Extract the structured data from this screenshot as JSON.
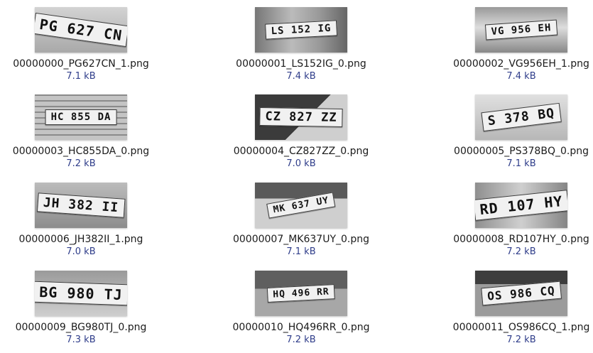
{
  "items": [
    {
      "plate": "PG 627 CN",
      "name": "00000000_PG627CN_1.png",
      "size": "7.1 kB"
    },
    {
      "plate": "LS 152 IG",
      "name": "00000001_LS152IG_0.png",
      "size": "7.4 kB"
    },
    {
      "plate": "VG 956 EH",
      "name": "00000002_VG956EH_1.png",
      "size": "7.4 kB"
    },
    {
      "plate": "HC 855 DA",
      "name": "00000003_HC855DA_0.png",
      "size": "7.2 kB"
    },
    {
      "plate": "CZ 827 ZZ",
      "name": "00000004_CZ827ZZ_0.png",
      "size": "7.0 kB"
    },
    {
      "plate": "S 378 BQ",
      "name": "00000005_PS378BQ_0.png",
      "size": "7.1 kB"
    },
    {
      "plate": "JH 382 II",
      "name": "00000006_JH382II_1.png",
      "size": "7.0 kB"
    },
    {
      "plate": "MK 637 UY",
      "name": "00000007_MK637UY_0.png",
      "size": "7.1 kB"
    },
    {
      "plate": "RD 107 HY",
      "name": "00000008_RD107HY_0.png",
      "size": "7.2 kB"
    },
    {
      "plate": "BG 980 TJ",
      "name": "00000009_BG980TJ_0.png",
      "size": "7.3 kB"
    },
    {
      "plate": "HQ 496 RR",
      "name": "00000010_HQ496RR_0.png",
      "size": "7.2 kB"
    },
    {
      "plate": "OS 986 CQ",
      "name": "00000011_OS986CQ_1.png",
      "size": "7.2 kB"
    }
  ]
}
